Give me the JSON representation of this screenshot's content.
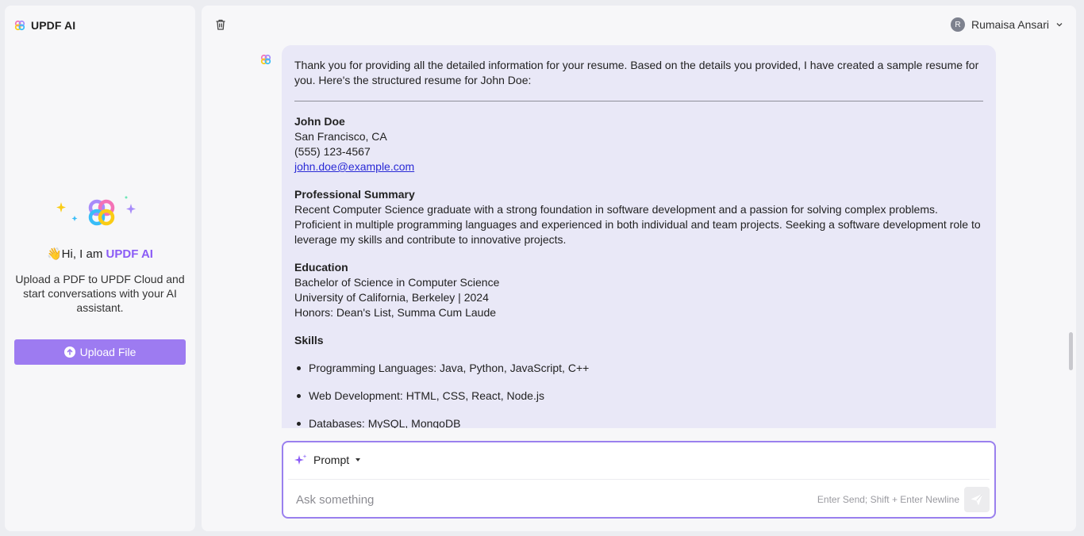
{
  "app": {
    "title": "UPDF AI"
  },
  "sidebar": {
    "greeting_prefix": "👋Hi, I am ",
    "greeting_name": "UPDF AI",
    "description": "Upload a PDF to UPDF Cloud and start conversations with your AI assistant.",
    "upload_label": "Upload File"
  },
  "header": {
    "user_initial": "R",
    "user_name": "Rumaisa Ansari"
  },
  "message": {
    "intro": "Thank you for providing all the detailed information for your resume. Based on the details you provided, I have created a sample resume for you. Here's the structured resume for John Doe:",
    "contact": {
      "name": "John Doe",
      "location": "San Francisco, CA",
      "phone": "(555) 123-4567",
      "email": "john.doe@example.com"
    },
    "summary": {
      "heading": "Professional Summary",
      "text": "Recent Computer Science graduate with a strong foundation in software development and a passion for solving complex problems. Proficient in multiple programming languages and experienced in both individual and team projects. Seeking a software development role to leverage my skills and contribute to innovative projects."
    },
    "education": {
      "heading": "Education",
      "degree": "Bachelor of Science in Computer Science",
      "school": "University of California, Berkeley | 2024",
      "honors": "Honors: Dean's List, Summa Cum Laude"
    },
    "skills": {
      "heading": "Skills",
      "items": [
        "Programming Languages: Java, Python, JavaScript, C++",
        "Web Development: HTML, CSS, React, Node.js",
        "Databases: MySQL, MongoDB"
      ]
    }
  },
  "composer": {
    "prompt_label": "Prompt",
    "placeholder": "Ask something",
    "hint": "Enter Send; Shift + Enter Newline"
  },
  "colors": {
    "accent": "#9d7bf1",
    "bubble": "#e9e8f7",
    "border": "#9a80ee"
  },
  "icons": {
    "logo": "updf-logo-icon",
    "trash": "trash-icon",
    "upload": "upload-arrow-icon",
    "sparkle": "sparkle-icon",
    "send": "send-icon",
    "chevron": "chevron-down-icon"
  }
}
